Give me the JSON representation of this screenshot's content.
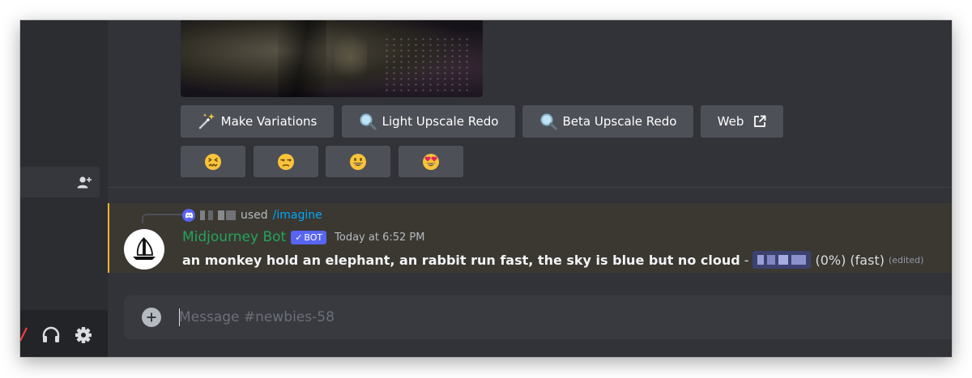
{
  "colors": {
    "chat_bg": "#313338",
    "sidebar_bg": "#2b2d31",
    "button_bg": "#4e5058",
    "mention_highlight_bg": "#3b3832",
    "mention_bar": "#f0b232",
    "bot_name": "#23a559",
    "bot_tag": "#5865f2",
    "link": "#00a8fc"
  },
  "buttons": {
    "make_variations": {
      "label": "Make Variations",
      "icon": "magic-wand-icon"
    },
    "light_upscale_redo": {
      "label": "Light Upscale Redo",
      "icon": "magnifier-icon"
    },
    "beta_upscale_redo": {
      "label": "Beta Upscale Redo",
      "icon": "magnifier-icon"
    },
    "web": {
      "label": "Web",
      "icon": "external-link-icon"
    }
  },
  "reactions": [
    {
      "icon": "confounded-face-icon"
    },
    {
      "icon": "unamused-face-icon"
    },
    {
      "icon": "grinning-face-icon"
    },
    {
      "icon": "heart-eyes-face-icon"
    }
  ],
  "message": {
    "reply": {
      "used_text": "used",
      "command": "/imagine"
    },
    "author": "Midjourney Bot",
    "bot_tag": "BOT",
    "bot_tag_check": "✓",
    "timestamp": "Today at 6:52 PM",
    "prompt": "an monkey hold an elephant, an rabbit run fast, the sky is blue but no cloud",
    "separator": "-",
    "status": "(0%) (fast)",
    "edited": "(edited)"
  },
  "composer": {
    "placeholder": "Message #newbies-58"
  },
  "user_panel": {
    "icons": [
      "mute-mic-icon",
      "headphones-icon",
      "settings-gear-icon"
    ]
  }
}
